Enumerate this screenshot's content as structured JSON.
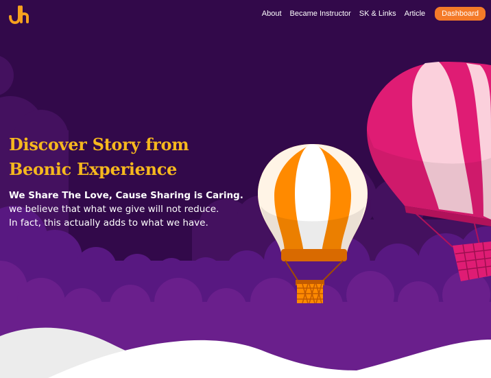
{
  "brand": {
    "logo_text": "Jh",
    "logo_color": "#f6a11e"
  },
  "nav": {
    "links": [
      "About",
      "Became Instructor",
      "SK & Links",
      "Article"
    ],
    "dashboard_label": "Dashboard"
  },
  "hero": {
    "title_line1": "Discover Story from",
    "title_line2": "Beonic Experience",
    "tagline": "We Share The Love, Cause Sharing is Caring.",
    "line1": "we believe that what we give will not reduce.",
    "line2": "In fact, this actually adds to what we have."
  },
  "colors": {
    "background": "#32094a",
    "cloud_dark": "#4a1467",
    "cloud_mid": "#6a1f8c",
    "accent_orange": "#f47a29",
    "title_yellow": "#f6b81e",
    "balloon_pink": "#df1c74",
    "balloon_orange": "#ff8a00"
  }
}
